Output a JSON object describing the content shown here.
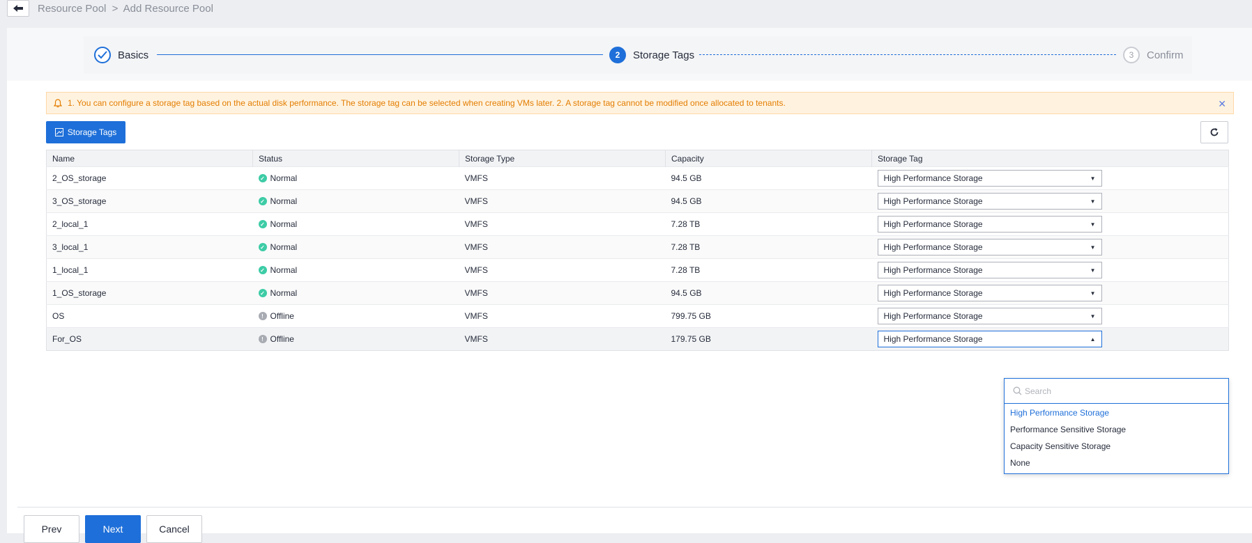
{
  "breadcrumb": {
    "parent": "Resource Pool",
    "separator": ">",
    "current": "Add Resource Pool"
  },
  "steps": [
    {
      "label": "Basics",
      "state": "done"
    },
    {
      "number": "2",
      "label": "Storage Tags",
      "state": "active"
    },
    {
      "number": "3",
      "label": "Confirm",
      "state": "pending"
    }
  ],
  "alert": {
    "text": "1. You can configure a storage tag based on the actual disk performance. The storage tag can be selected when creating VMs later. 2. A storage tag cannot be modified once allocated to tenants."
  },
  "toolbar": {
    "storage_tags_label": "Storage Tags"
  },
  "table": {
    "headers": [
      "Name",
      "Status",
      "Storage Type",
      "Capacity",
      "Storage Tag"
    ],
    "rows": [
      {
        "name": "2_OS_storage",
        "status": "Normal",
        "type": "VMFS",
        "capacity": "94.5 GB",
        "tag": "High Performance Storage"
      },
      {
        "name": "3_OS_storage",
        "status": "Normal",
        "type": "VMFS",
        "capacity": "94.5 GB",
        "tag": "High Performance Storage"
      },
      {
        "name": "2_local_1",
        "status": "Normal",
        "type": "VMFS",
        "capacity": "7.28 TB",
        "tag": "High Performance Storage"
      },
      {
        "name": "3_local_1",
        "status": "Normal",
        "type": "VMFS",
        "capacity": "7.28 TB",
        "tag": "High Performance Storage"
      },
      {
        "name": "1_local_1",
        "status": "Normal",
        "type": "VMFS",
        "capacity": "7.28 TB",
        "tag": "High Performance Storage"
      },
      {
        "name": "1_OS_storage",
        "status": "Normal",
        "type": "VMFS",
        "capacity": "94.5 GB",
        "tag": "High Performance Storage"
      },
      {
        "name": "OS",
        "status": "Offline",
        "type": "VMFS",
        "capacity": "799.75 GB",
        "tag": "High Performance Storage"
      },
      {
        "name": "For_OS",
        "status": "Offline",
        "type": "VMFS",
        "capacity": "179.75 GB",
        "tag": "High Performance Storage"
      }
    ]
  },
  "dropdown": {
    "search_placeholder": "Search",
    "options": [
      "High Performance Storage",
      "Performance Sensitive Storage",
      "Capacity Sensitive Storage",
      "None"
    ],
    "selected": "High Performance Storage"
  },
  "footer": {
    "prev": "Prev",
    "next": "Next",
    "cancel": "Cancel"
  },
  "colors": {
    "primary": "#1e6fd9",
    "warning_text": "#e37d00",
    "warning_bg": "#fff3e0",
    "status_normal": "#3dcca6",
    "status_offline": "#a8abb2"
  },
  "icons": {
    "back": "arrow-left-icon",
    "step_done": "check-icon",
    "alert": "bell-icon",
    "close": "close-icon",
    "storage_tags": "tag-icon",
    "refresh": "refresh-icon",
    "search": "search-icon"
  }
}
